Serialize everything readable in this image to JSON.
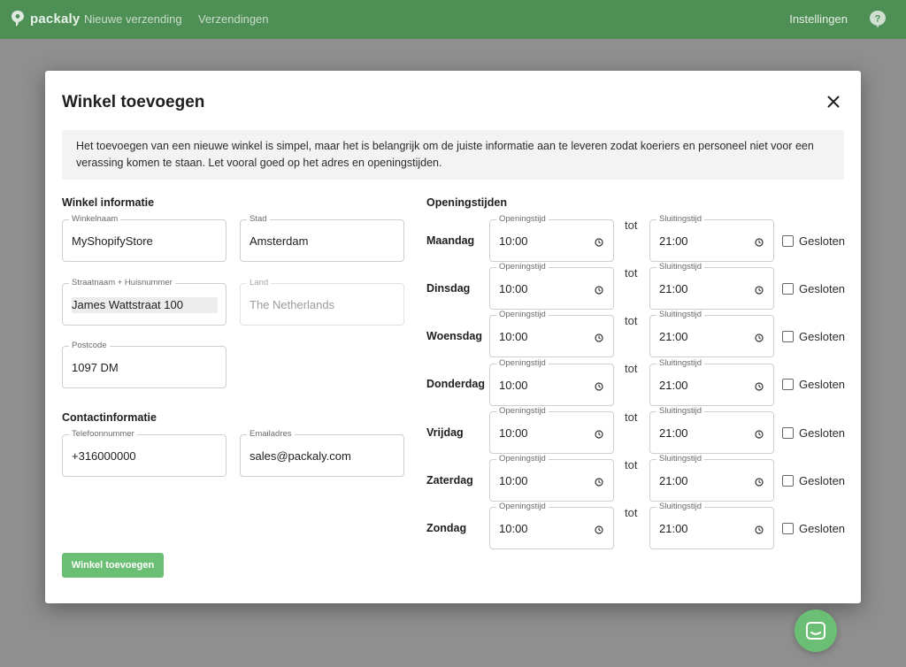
{
  "nav": {
    "brand": "packaly",
    "new_shipment": "Nieuwe verzending",
    "shipments": "Verzendingen",
    "settings": "Instellingen"
  },
  "icons": {
    "logo": "pin-icon",
    "help": "help-icon",
    "close": "close-icon",
    "clock": "clock-icon",
    "chat": "chat-icon"
  },
  "colors": {
    "topbar": "#4d8f54",
    "accent": "#6bbf74"
  },
  "modal": {
    "title": "Winkel toevoegen",
    "info": "Het toevoegen van een nieuwe winkel is simpel, maar het is belangrijk om de juiste informatie aan te leveren zodat koeriers en personeel niet voor een verassing komen te staan. Let vooral goed op het adres en openingstijden.",
    "store_section": "Winkel informatie",
    "contact_section": "Contactinformatie",
    "hours_section": "Openingstijden",
    "fields": {
      "store_name": {
        "label": "Winkelnaam",
        "value": "MyShopifyStore"
      },
      "city": {
        "label": "Stad",
        "value": "Amsterdam"
      },
      "street": {
        "label": "Straatnaam + Huisnummer",
        "value": "James Wattstraat 100"
      },
      "country": {
        "label": "Land",
        "value": "The Netherlands"
      },
      "postcode": {
        "label": "Postcode",
        "value": "1097 DM"
      },
      "phone": {
        "label": "Telefoonnummer",
        "value": "+316000000"
      },
      "email": {
        "label": "Emailadres",
        "value": "sales@packaly.com"
      }
    },
    "hours": {
      "open_label": "Openingstijd",
      "close_label": "Sluitingstijd",
      "to": "tot",
      "closed_label": "Gesloten",
      "days": [
        {
          "name": "Maandag",
          "open": "10:00",
          "close": "21:00",
          "closed": false
        },
        {
          "name": "Dinsdag",
          "open": "10:00",
          "close": "21:00",
          "closed": false
        },
        {
          "name": "Woensdag",
          "open": "10:00",
          "close": "21:00",
          "closed": false
        },
        {
          "name": "Donderdag",
          "open": "10:00",
          "close": "21:00",
          "closed": false
        },
        {
          "name": "Vrijdag",
          "open": "10:00",
          "close": "21:00",
          "closed": false
        },
        {
          "name": "Zaterdag",
          "open": "10:00",
          "close": "21:00",
          "closed": false
        },
        {
          "name": "Zondag",
          "open": "10:00",
          "close": "21:00",
          "closed": false
        }
      ]
    },
    "submit": "Winkel toevoegen"
  }
}
